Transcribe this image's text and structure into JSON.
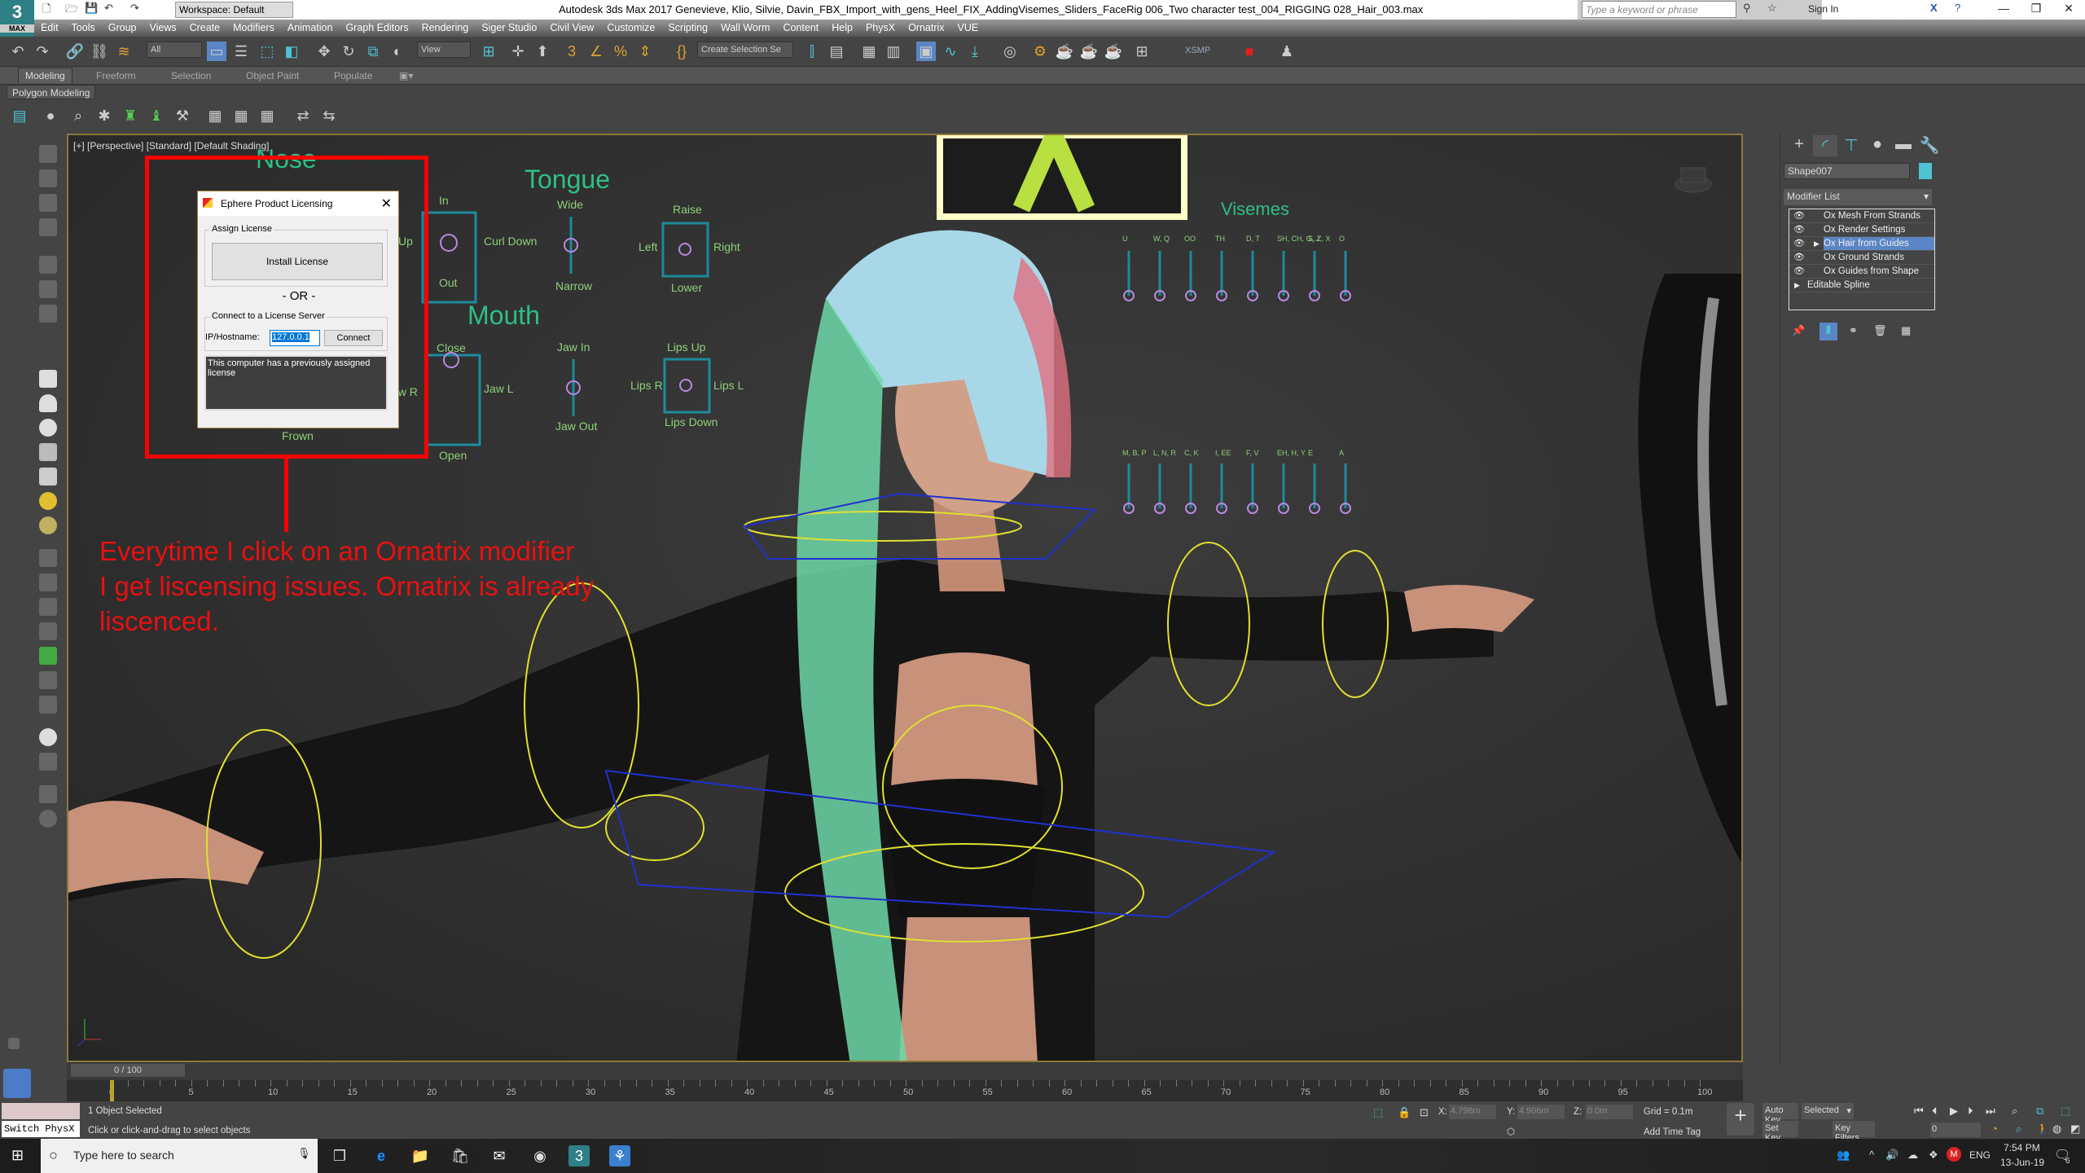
{
  "app": {
    "logo": "3",
    "logo_sub": "MAX",
    "workspace": "Workspace: Default",
    "title": "Autodesk 3ds Max 2017    Genevieve, Klio, Silvie, Davin_FBX_Import_with_gens_Heel_FIX_AddingVisemes_Sliders_FaceRig 006_Two character test_004_RIGGING 028_Hair_003.max",
    "search_placeholder": "Type a keyword or phrase",
    "sign_in": "Sign In"
  },
  "menu": [
    "Edit",
    "Tools",
    "Group",
    "Views",
    "Create",
    "Modifiers",
    "Animation",
    "Graph Editors",
    "Rendering",
    "Siger Studio",
    "Civil View",
    "Customize",
    "Scripting",
    "Wall Worm",
    "Content",
    "Help",
    "PhysX",
    "Ornatrix",
    "VUE"
  ],
  "toolbar": {
    "filter": "All",
    "ref_coord": "View",
    "selection_set": "Create Selection Se",
    "xsmp": "XSMP"
  },
  "ribbon": {
    "tabs": [
      "Modeling",
      "Freeform",
      "Selection",
      "Object Paint",
      "Populate"
    ],
    "panel": "Polygon Modeling"
  },
  "viewport": {
    "label": "[+] [Perspective] [Standard] [Default Shading]",
    "rig": {
      "nose": "Nose",
      "tongue": "Tongue",
      "mouth": "Mouth",
      "visemes": "Visemes",
      "labels": [
        "In",
        "Out",
        "Up",
        "Curl Down",
        "Wide",
        "Narrow",
        "Raise",
        "Lower",
        "Left",
        "Right",
        "Close",
        "Open",
        "Jaw R",
        "Jaw L",
        "Jaw In",
        "Jaw Out",
        "Lips Up",
        "Lips Down",
        "Lips R",
        "Lips L",
        "Frown"
      ],
      "visemes_top": [
        "U",
        "W, Q",
        "OO",
        "TH",
        "D, T",
        "SH, CH, G, J",
        "S, Z, X",
        "O"
      ],
      "visemes_bottom": [
        "M, B, P",
        "L, N, R",
        "C, K",
        "I, EE",
        "F, V",
        "EH, H, Y",
        "E",
        "A"
      ]
    }
  },
  "dialog": {
    "title": "Ephere Product Licensing",
    "assign_group": "Assign License",
    "install_button": "Install License",
    "or": "- OR -",
    "server_group": "Connect to a License Server",
    "ip_label": "IP/Hostname:",
    "ip_value": "127.0.0.1",
    "connect_button": "Connect",
    "message": "This computer has a previously assigned license"
  },
  "annotation": {
    "text": "Everytime I click on an Ornatrix modifier\nI get liscensing issues. Ornatrix is already\nliscenced.",
    "color": "#e81010"
  },
  "command_panel": {
    "object_name": "Shape007",
    "object_color": "#4fc3d3",
    "modifier_list": "Modifier List",
    "stack": [
      {
        "label": "Ox Mesh From Strands",
        "selected": false
      },
      {
        "label": "Ox Render Settings",
        "selected": false
      },
      {
        "label": "Ox Hair from Guides",
        "selected": true
      },
      {
        "label": "Ox Ground Strands",
        "selected": false
      },
      {
        "label": "Ox Guides from Shape",
        "selected": false
      }
    ],
    "base_object": "Editable Spline"
  },
  "timeline": {
    "slider": "0 / 100",
    "current": 0,
    "ticks": [
      "0",
      "5",
      "10",
      "15",
      "20",
      "25",
      "30",
      "35",
      "40",
      "45",
      "50",
      "55",
      "60",
      "65",
      "70",
      "75",
      "80",
      "85",
      "90",
      "95",
      "100"
    ]
  },
  "status": {
    "selected": "1 Object Selected",
    "prompt": "Click or click-and-drag to select objects",
    "switch": "Switch PhysX",
    "x": "4.798m",
    "y": "4.906m",
    "z": "0.0m",
    "x_label": "X:",
    "y_label": "Y:",
    "z_label": "Z:",
    "grid": "Grid = 0.1m",
    "time_tag": "Add Time Tag",
    "auto_key": "Auto Key",
    "set_key": "Set Key",
    "key_mode": "Selected",
    "key_filters": "Key Filters...",
    "frame": "0"
  },
  "taskbar": {
    "search_placeholder": "Type here to search",
    "lang": "ENG",
    "time": "7:54 PM",
    "date": "13-Jun-19",
    "notifications": "6"
  }
}
